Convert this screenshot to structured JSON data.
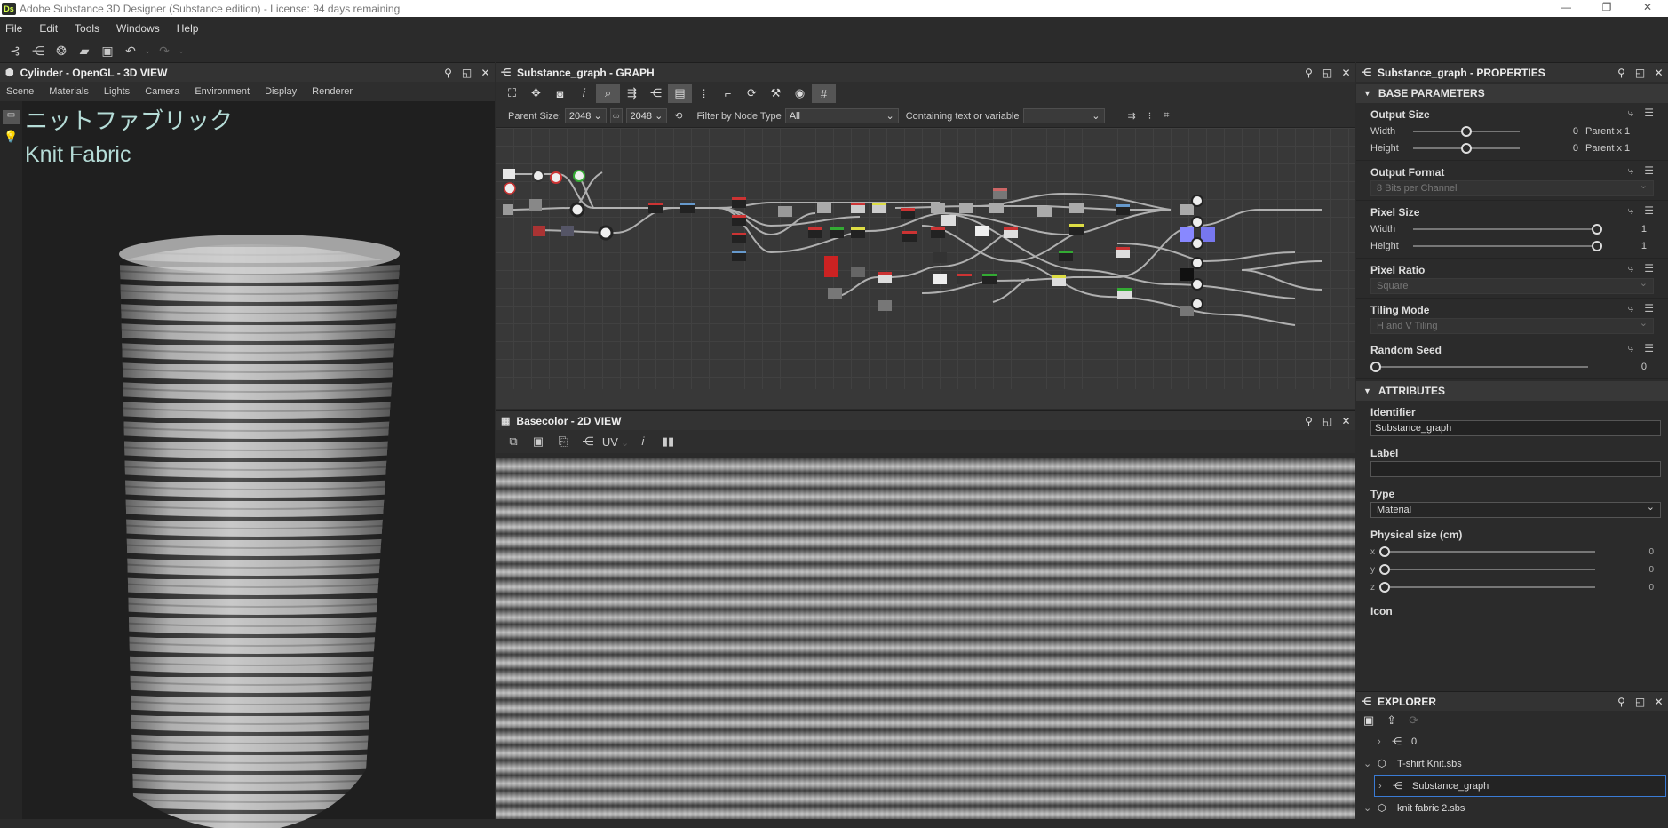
{
  "window": {
    "title": "Adobe Substance 3D Designer (Substance edition) - License: 94 days remaining",
    "logo": "Ds"
  },
  "menu": [
    "File",
    "Edit",
    "Tools",
    "Windows",
    "Help"
  ],
  "view3d": {
    "title": "Cylinder - OpenGL - 3D VIEW",
    "tabs": [
      "Scene",
      "Materials",
      "Lights",
      "Camera",
      "Environment",
      "Display",
      "Renderer"
    ],
    "overlay_jp": "ニットファブリック",
    "overlay_en": "Knit Fabric"
  },
  "graph": {
    "title": "Substance_graph - GRAPH",
    "parent_size_label": "Parent Size:",
    "parent_size_w": "2048",
    "parent_size_h": "2048",
    "filter_label": "Filter by Node Type",
    "filter_value": "All",
    "containing_label": "Containing text or variable"
  },
  "view2d": {
    "title": "Basecolor - 2D VIEW",
    "uv_label": "UV"
  },
  "properties": {
    "title": "Substance_graph - PROPERTIES",
    "base_section": "BASE PARAMETERS",
    "output_size": {
      "label": "Output Size",
      "width_label": "Width",
      "height_label": "Height",
      "width_value": "0",
      "height_value": "0",
      "width_parent": "Parent x 1",
      "height_parent": "Parent x 1",
      "width_fraction": 0.5,
      "height_fraction": 0.5
    },
    "output_format": {
      "label": "Output Format",
      "value": "8 Bits per Channel"
    },
    "pixel_size": {
      "label": "Pixel Size",
      "width_label": "Width",
      "height_label": "Height",
      "width_value": "1",
      "height_value": "1"
    },
    "pixel_ratio": {
      "label": "Pixel Ratio",
      "value": "Square"
    },
    "tiling_mode": {
      "label": "Tiling Mode",
      "value": "H and V Tiling"
    },
    "random_seed": {
      "label": "Random Seed",
      "value": "0"
    },
    "attr_section": "ATTRIBUTES",
    "identifier": {
      "label": "Identifier",
      "value": "Substance_graph"
    },
    "label_field": {
      "label": "Label",
      "value": ""
    },
    "type": {
      "label": "Type",
      "value": "Material"
    },
    "physical_size": {
      "label": "Physical size (cm)",
      "x": "0",
      "y": "0",
      "z": "0"
    },
    "icon": {
      "label": "Icon"
    }
  },
  "explorer": {
    "title": "EXPLORER",
    "items": [
      {
        "label": "0"
      },
      {
        "label": "T-shirt Knit.sbs"
      },
      {
        "label": "Substance_graph"
      },
      {
        "label": "knit fabric 2.sbs"
      }
    ]
  }
}
